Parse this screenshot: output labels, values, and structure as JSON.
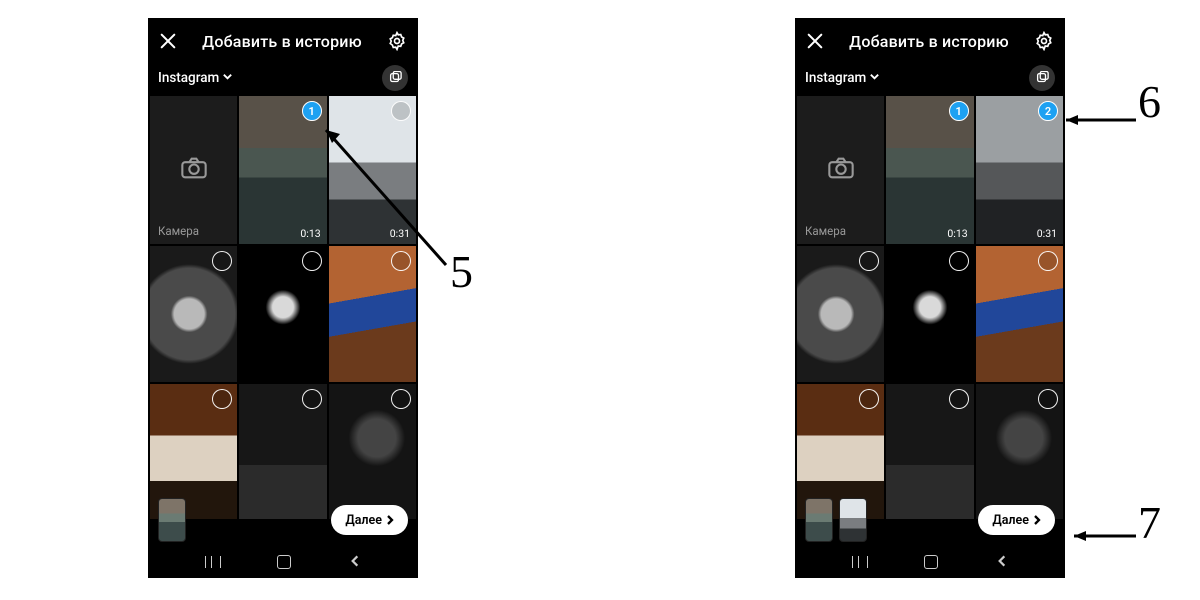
{
  "left": {
    "header": {
      "title": "Добавить в историю"
    },
    "album": {
      "selected": "Instagram",
      "camera_label": "Камера"
    },
    "grid": {
      "cells": [
        {
          "type": "camera"
        },
        {
          "type": "video",
          "klass": "img-coast",
          "duration": "0:13",
          "sel_num": "1"
        },
        {
          "type": "video",
          "klass": "img-rocks",
          "duration": "0:31",
          "sel_num": null
        },
        {
          "type": "img",
          "klass": "img-skull",
          "sel_num": null
        },
        {
          "type": "img",
          "klass": "img-face",
          "sel_num": null
        },
        {
          "type": "img",
          "klass": "img-room",
          "sel_num": null
        },
        {
          "type": "img",
          "klass": "img-cat",
          "sel_num": null
        },
        {
          "type": "img",
          "klass": "img-dark1",
          "sel_num": null
        },
        {
          "type": "img",
          "klass": "img-dark2",
          "sel_num": null
        }
      ]
    },
    "next_label": "Далее",
    "thumbs": [
      {
        "klass": "img-coast"
      }
    ]
  },
  "right": {
    "header": {
      "title": "Добавить в историю"
    },
    "album": {
      "selected": "Instagram",
      "camera_label": "Камера"
    },
    "grid": {
      "cells": [
        {
          "type": "camera"
        },
        {
          "type": "video",
          "klass": "img-coast",
          "duration": "0:13",
          "sel_num": "1"
        },
        {
          "type": "video",
          "klass": "img-rocks",
          "duration": "0:31",
          "sel_num": "2"
        },
        {
          "type": "img",
          "klass": "img-skull",
          "sel_num": null
        },
        {
          "type": "img",
          "klass": "img-face",
          "sel_num": null
        },
        {
          "type": "img",
          "klass": "img-room",
          "sel_num": null
        },
        {
          "type": "img",
          "klass": "img-cat",
          "sel_num": null
        },
        {
          "type": "img",
          "klass": "img-dark1",
          "sel_num": null
        },
        {
          "type": "img",
          "klass": "img-dark2",
          "sel_num": null
        }
      ]
    },
    "next_label": "Далее",
    "thumbs": [
      {
        "klass": "img-coast"
      },
      {
        "klass": "img-rocks"
      }
    ]
  },
  "annotations": {
    "a5": "5",
    "a6": "6",
    "a7": "7"
  }
}
